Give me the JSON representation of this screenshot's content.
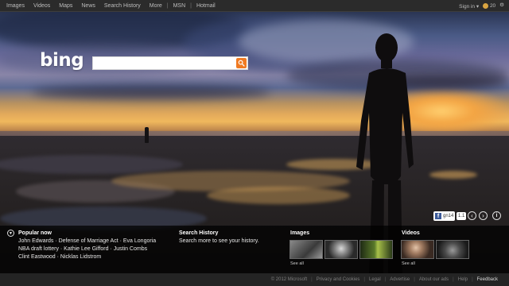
{
  "topbar": {
    "nav": [
      "Images",
      "Videos",
      "Maps",
      "News",
      "Search History",
      "More"
    ],
    "nav2": [
      "MSN",
      "Hotmail"
    ],
    "sign_in": "Sign in",
    "rewards_count": "20"
  },
  "logo": {
    "text": "bing"
  },
  "search": {
    "value": "",
    "placeholder": ""
  },
  "image_tools": {
    "like_count": "gn14",
    "page_indicator": "1.1"
  },
  "popular": {
    "title": "Popular now",
    "lines": [
      "John Edwards · Defense of Marriage Act · Eva Longoria",
      "NBA draft lottery · Kathie Lee Gifford · Justin Combs",
      "Clint Eastwood · Nicklas Lidstrom"
    ]
  },
  "search_history": {
    "title": "Search History",
    "text": "Search more to see your history."
  },
  "images": {
    "title": "Images",
    "see_all": "See all"
  },
  "videos": {
    "title": "Videos",
    "see_all": "See all"
  },
  "footer": {
    "copyright": "© 2012 Microsoft",
    "links": [
      "Privacy and Cookies",
      "Legal",
      "Advertise",
      "About our ads",
      "Help"
    ],
    "feedback": "Feedback"
  },
  "colors": {
    "accent": "#f07a22",
    "facebook": "#3b5998"
  }
}
